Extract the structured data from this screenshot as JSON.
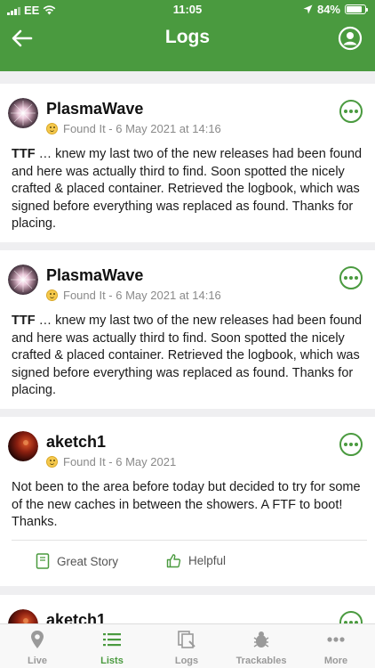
{
  "status_bar": {
    "carrier": "EE",
    "time": "11:05",
    "battery": "84%",
    "battery_level": 0.84
  },
  "header": {
    "title": "Logs"
  },
  "logs": [
    {
      "user": "PlasmaWave",
      "meta": "Found It - 6 May 2021 at 14:16",
      "text_bold": "TTF",
      "text": " … knew my last two of the new releases had been found and here was actually third to find. Soon spotted the nicely crafted & placed container. Retrieved the logbook, which was signed before everything was replaced as found. Thanks for placing."
    },
    {
      "user": "PlasmaWave",
      "meta": "Found It - 6 May 2021 at 14:16",
      "text_bold": "TTF",
      "text": " … knew my last two of the new releases had been found and here was actually third to find. Soon spotted the nicely crafted & placed container. Retrieved the logbook, which was signed before everything was replaced as found. Thanks for placing."
    },
    {
      "user": "aketch1",
      "meta": "Found It - 6 May 2021",
      "text": "Not been to the area before today but decided to try for some of the new caches in between the showers. A FTF to boot! Thanks.",
      "actions": {
        "great_story": "Great Story",
        "helpful": "Helpful"
      }
    },
    {
      "user": "aketch1"
    }
  ],
  "tabs": [
    {
      "label": "Live",
      "icon": "map-pin-icon",
      "active": false
    },
    {
      "label": "Lists",
      "icon": "list-icon",
      "active": true
    },
    {
      "label": "Logs",
      "icon": "logs-icon",
      "active": false
    },
    {
      "label": "Trackables",
      "icon": "bug-icon",
      "active": false
    },
    {
      "label": "More",
      "icon": "more-dots-icon",
      "active": false
    }
  ],
  "colors": {
    "brand_green": "#4a9a3f",
    "background": "#efeff1"
  }
}
